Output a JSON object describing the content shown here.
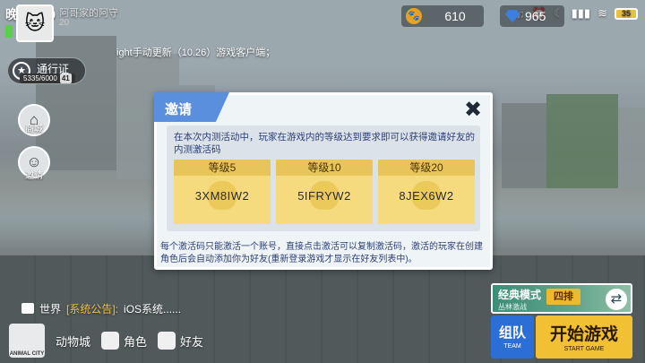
{
  "status_bar": {
    "time": "晚上7:30",
    "battery": "35"
  },
  "player": {
    "name": "阿哥家的阿守",
    "level": "20"
  },
  "currency": {
    "coins": "610",
    "gems": "965"
  },
  "notice": "ight手动更新（10.26）游戏客户端；",
  "battle_pass": {
    "label": "通行证",
    "progress": "5335/6000",
    "level": "41"
  },
  "side_buttons": [
    {
      "label": "商城",
      "icon": "shop-icon"
    },
    {
      "label": "邀请",
      "icon": "invite-icon"
    }
  ],
  "dialog": {
    "title": "邀请",
    "description": "在本次内测活动中，玩家在游戏内的等级达到要求即可以获得邀请好友的内测激活码",
    "codes": [
      {
        "level": "等级5",
        "code": "3XM8IW2"
      },
      {
        "level": "等级10",
        "code": "5IFRYW2"
      },
      {
        "level": "等级20",
        "code": "8JEX6W2"
      }
    ],
    "note": "每个激活码只能激活一个账号，直接点击激活可以复制激活码，激活的玩家在创建角色后会自动添加你为好友(重新登录游戏才显示在好友列表中)。"
  },
  "chat": {
    "channel": "世界",
    "tag": "[系统公告]:",
    "message": "iOS系统......"
  },
  "bottom_nav": {
    "logo_text": "ANIMAL CITY",
    "items": [
      {
        "label": "动物城"
      },
      {
        "label": "角色"
      },
      {
        "label": "好友"
      }
    ]
  },
  "game_mode": {
    "name": "经典模式",
    "sub": "丛林激战",
    "badge": "四排"
  },
  "team_button": {
    "label": "组队",
    "sub": "TEAM"
  },
  "start_button": {
    "label": "开始游戏",
    "sub": "START GAME"
  },
  "colors": {
    "dialog_tab": "#5a8fdd",
    "code_card": "#f5db7d",
    "start_button": "#f2c033",
    "team_button": "#2b6fd6"
  }
}
